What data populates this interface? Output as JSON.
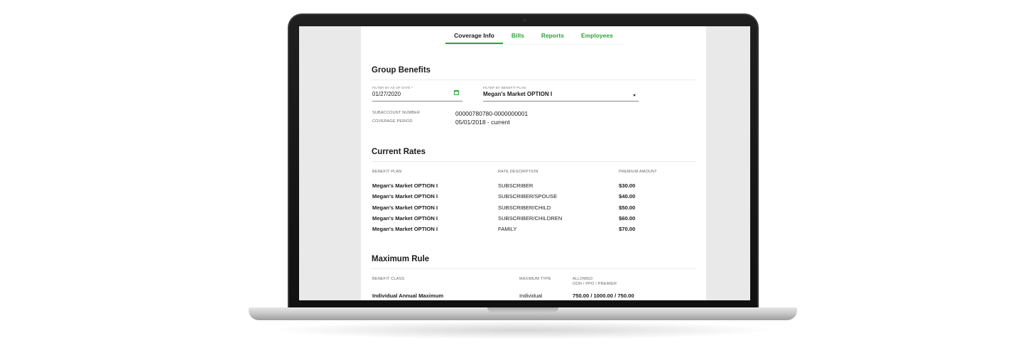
{
  "tabs": [
    {
      "label": "Coverage Info",
      "active": true
    },
    {
      "label": "Bills",
      "active": false
    },
    {
      "label": "Reports",
      "active": false
    },
    {
      "label": "Employees",
      "active": false
    }
  ],
  "group_benefits": {
    "title": "Group Benefits",
    "date_filter": {
      "label": "FILTER BY AS OF DATE *",
      "value": "01/27/2020",
      "icon": "calendar-icon"
    },
    "plan_filter": {
      "label": "FILTER BY BENEFIT PLAN",
      "value": "Megan's Market OPTION I",
      "icon": "chevron-down-icon"
    },
    "subaccount": {
      "label": "SUBACCOUNT NUMBER",
      "value": "00000780780-0000000001"
    },
    "coverage_period": {
      "label": "COVERAGE PERIOD",
      "value": "05/01/2018 - current"
    }
  },
  "current_rates": {
    "title": "Current Rates",
    "headers": [
      "BENEFIT PLAN",
      "RATE DESCRIPTION",
      "PREMIUM AMOUNT"
    ],
    "rows": [
      [
        "Megan's Market OPTION I",
        "SUBSCRIBER",
        "$30.00"
      ],
      [
        "Megan's Market OPTION I",
        "SUBSCRIBER/SPOUSE",
        "$40.00"
      ],
      [
        "Megan's Market OPTION I",
        "SUBSCRIBER/CHILD",
        "$50.00"
      ],
      [
        "Megan's Market OPTION I",
        "SUBSCRIBER/CHILDREN",
        "$60.00"
      ],
      [
        "Megan's Market OPTION I",
        "FAMILY",
        "$70.00"
      ]
    ]
  },
  "maximum_rule": {
    "title": "Maximum Rule",
    "headers": {
      "benefit_class": "BENEFIT CLASS",
      "maximum_type": "MAXIMUM TYPE",
      "allowed": "ALLOWED",
      "allowed_sub": "OON / PPO / PREMIER"
    },
    "rows": [
      [
        "Individual Annual Maximum",
        "Individual",
        "750.00 / 1000.00 / 750.00"
      ]
    ]
  },
  "colors": {
    "accent": "#2fa33a",
    "screen_bg": "#e9e9e9",
    "bezel": "#111111"
  }
}
